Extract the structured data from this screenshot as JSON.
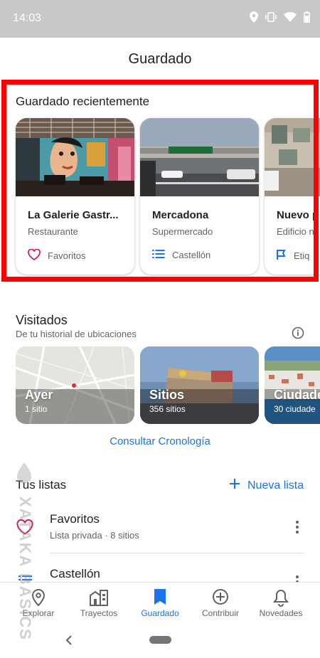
{
  "status_bar": {
    "time": "14:03"
  },
  "app": {
    "title": "Guardado"
  },
  "recent": {
    "title": "Guardado recientemente",
    "cards": [
      {
        "name": "La Galerie Gastr...",
        "type": "Restaurante",
        "list": "Favoritos",
        "list_icon": "heart-icon"
      },
      {
        "name": "Mercadona",
        "type": "Supermercado",
        "list": "Castellón",
        "list_icon": "list-icon"
      },
      {
        "name": "Nuevo p",
        "type": "Edificio n",
        "list": "Etiq",
        "list_icon": "flag-icon"
      }
    ]
  },
  "visited": {
    "title": "Visitados",
    "subtitle": "De tu historial de ubicaciones",
    "cards": [
      {
        "title": "Ayer",
        "count": "1 sitio"
      },
      {
        "title": "Sitios",
        "count": "356 sitios"
      },
      {
        "title": "Ciudade",
        "count": "30 ciudade"
      }
    ],
    "timeline_link": "Consultar Cronología"
  },
  "lists": {
    "title": "Tus listas",
    "new_list_label": "Nueva lista",
    "items": [
      {
        "name": "Favoritos",
        "meta": "Lista privada · 8 sitios"
      },
      {
        "name": "Castellón",
        "meta": ""
      }
    ]
  },
  "bottom_nav": [
    {
      "label": "Explorar",
      "icon": "pin-icon"
    },
    {
      "label": "Trayectos",
      "icon": "commute-icon"
    },
    {
      "label": "Guardado",
      "icon": "bookmark-icon",
      "active": true
    },
    {
      "label": "Contribuir",
      "icon": "add-circle-icon"
    },
    {
      "label": "Novedades",
      "icon": "bell-icon"
    }
  ],
  "watermark": {
    "text": "XATAKA BASICS"
  },
  "colors": {
    "accent": "#1a73e8",
    "highlight": "#ff0000",
    "favorite": "#d81b60"
  }
}
